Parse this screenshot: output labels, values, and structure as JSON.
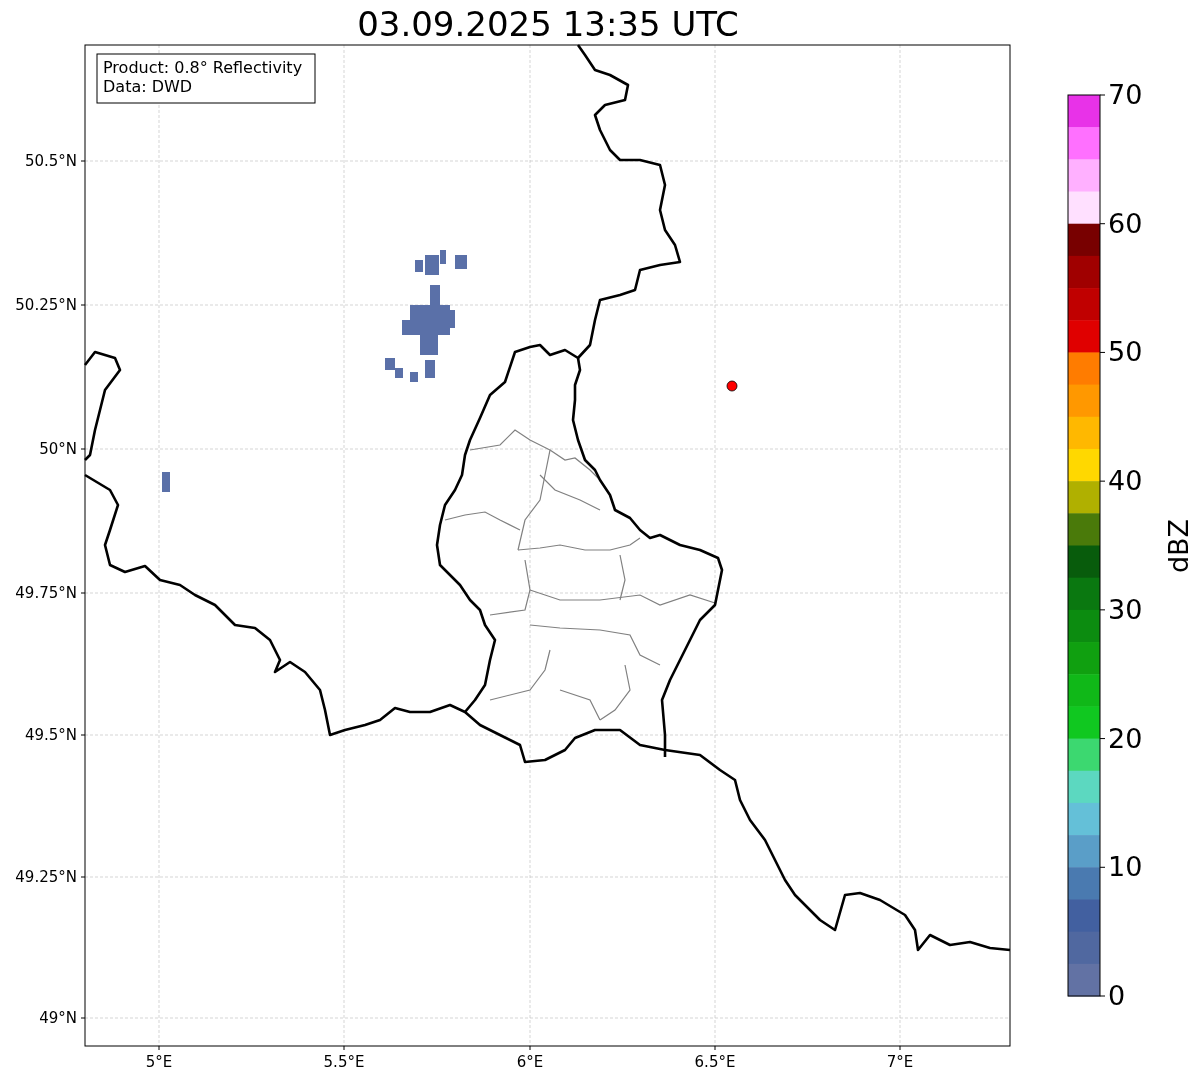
{
  "title": "03.09.2025 13:35 UTC",
  "info_box": {
    "lines": [
      "Product: 0.8° Reflectivity",
      "Data: DWD"
    ]
  },
  "map": {
    "x_tick_labels": [
      "5°E",
      "5.5°E",
      "6°E",
      "6.5°E",
      "7°E"
    ],
    "y_tick_labels": [
      "50.5°N",
      "50.25°N",
      "50°N",
      "49.75°N",
      "49.5°N",
      "49.25°N",
      "49°N"
    ]
  },
  "colorbar": {
    "label": "dBZ",
    "tick_labels": [
      "70",
      "60",
      "50",
      "40",
      "30",
      "20",
      "10",
      "0"
    ],
    "segments": [
      {
        "color": "#e832e8"
      },
      {
        "color": "#ff70ff"
      },
      {
        "color": "#ffb0ff"
      },
      {
        "color": "#ffe0ff"
      },
      {
        "color": "#780000"
      },
      {
        "color": "#a00000"
      },
      {
        "color": "#c00000"
      },
      {
        "color": "#e00000"
      },
      {
        "color": "#ff7c00"
      },
      {
        "color": "#ff9800"
      },
      {
        "color": "#ffb800"
      },
      {
        "color": "#ffd800"
      },
      {
        "color": "#b0b000"
      },
      {
        "color": "#4a7a0a"
      },
      {
        "color": "#085c0c"
      },
      {
        "color": "#0a7810"
      },
      {
        "color": "#0c8c10"
      },
      {
        "color": "#10a010"
      },
      {
        "color": "#10b818"
      },
      {
        "color": "#10c820"
      },
      {
        "color": "#3cd870"
      },
      {
        "color": "#5cd8c0"
      },
      {
        "color": "#64c0d8"
      },
      {
        "color": "#5a9ec8"
      },
      {
        "color": "#4a7ab0"
      },
      {
        "color": "#4260a0"
      },
      {
        "color": "#5068a0"
      },
      {
        "color": "#6272a4"
      }
    ]
  }
}
